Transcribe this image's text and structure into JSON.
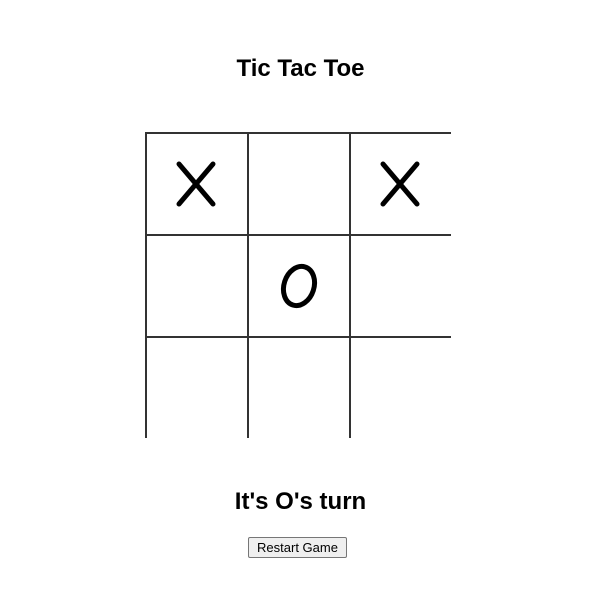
{
  "game": {
    "title": "Tic Tac Toe",
    "status_text": "It's O's turn",
    "restart_label": "Restart Game",
    "current_player": "O",
    "board": [
      [
        "X",
        "",
        "X"
      ],
      [
        "",
        "O",
        ""
      ],
      [
        "",
        "",
        ""
      ]
    ]
  },
  "colors": {
    "mark": "#000000",
    "grid": "#333333",
    "background": "#ffffff"
  }
}
